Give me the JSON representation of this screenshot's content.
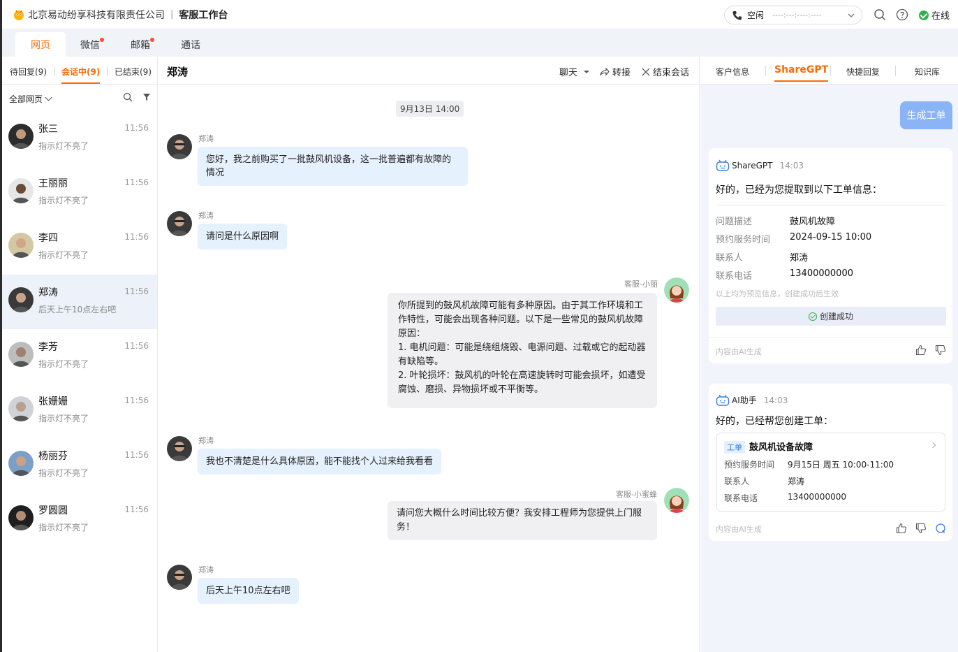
{
  "header": {
    "company": "北京易动纷享科技有限责任公司",
    "separator": "|",
    "app_title": "客服工作台",
    "status_label": "空闲",
    "timer": "----:---:----:----",
    "online_label": "在线"
  },
  "channel_tabs": [
    {
      "label": "网页",
      "active": true,
      "badge": false
    },
    {
      "label": "微信",
      "active": false,
      "badge": true
    },
    {
      "label": "邮箱",
      "active": false,
      "badge": true
    },
    {
      "label": "通话",
      "active": false,
      "badge": false
    }
  ],
  "session_tabs": [
    {
      "label": "待回复(9)"
    },
    {
      "label": "会话中(9)",
      "active": true
    },
    {
      "label": "已结束(9)"
    }
  ],
  "filter_label": "全部网页",
  "contacts": [
    {
      "name": "张三",
      "time": "11:56",
      "preview": "指示灯不亮了"
    },
    {
      "name": "王丽丽",
      "time": "11:56",
      "preview": "指示灯不亮了"
    },
    {
      "name": "李四",
      "time": "11:56",
      "preview": "指示灯不亮了"
    },
    {
      "name": "郑涛",
      "time": "11:56",
      "preview": "后天上午10点左右吧",
      "active": true
    },
    {
      "name": "李芳",
      "time": "11:56",
      "preview": "指示灯不亮了"
    },
    {
      "name": "张姗姗",
      "time": "11:56",
      "preview": "指示灯不亮了"
    },
    {
      "name": "杨丽芬",
      "time": "11:56",
      "preview": "指示灯不亮了"
    },
    {
      "name": "罗圆圆",
      "time": "11:56",
      "preview": "指示灯不亮了"
    }
  ],
  "chat": {
    "title": "郑涛",
    "mode_label": "聊天",
    "transfer_label": "转接",
    "end_label": "结束会话",
    "date_chip": "9月13日  14:00",
    "messages": [
      {
        "sender": "郑涛",
        "text": "您好，我之前购买了一批鼓风机设备，这一批普遍都有故障的情况"
      },
      {
        "sender": "郑涛",
        "text": "请问是什么原因啊"
      },
      {
        "sender": "客服-小丽",
        "text": "你所提到的鼓风机故障可能有多种原因。由于其工作环境和工作特性，可能会出现各种问题。以下是一些常见的鼓风机故障原因：\n1. 电机问题：可能是绕组烧毁、电源问题、过载或它的起动器有缺陷等。\n2. 叶轮损坏：鼓风机的叶轮在高速旋转时可能会损坏，如遭受腐蚀、磨损、异物损坏或不平衡等。"
      },
      {
        "sender": "郑涛",
        "text": "我也不清楚是什么具体原因，能不能找个人过来给我看看"
      },
      {
        "sender": "客服-小蜜蜂",
        "text": "请问您大概什么时间比较方便？我安排工程师为您提供上门服务！"
      },
      {
        "sender": "郑涛",
        "text": "后天上午10点左右吧"
      }
    ]
  },
  "assistant": {
    "tabs": [
      {
        "label": "客户信息"
      },
      {
        "label": "ShareGPT",
        "active": true
      },
      {
        "label": "快捷回复"
      },
      {
        "label": "知识库"
      }
    ],
    "generate_button": "生成工单",
    "card1": {
      "bot_name": "ShareGPT",
      "time": "14:03",
      "lead": "好的，已经为您提取到以下工单信息：",
      "fields": [
        {
          "k": "问题描述",
          "v": "鼓风机故障"
        },
        {
          "k": "预约服务时间",
          "v": "2024-09-15  10:00"
        },
        {
          "k": "联系人",
          "v": "郑涛"
        },
        {
          "k": "联系电话",
          "v": "13400000000"
        }
      ],
      "hint": "以上均为预览信息，创建成功后生效",
      "success": "创建成功",
      "footer_note": "内容由AI生成"
    },
    "card2": {
      "bot_name": "AI助手",
      "time": "14:03",
      "lead": "好的，已经帮您创建工单：",
      "ticket_tag": "工单",
      "ticket_title": "鼓风机设备故障",
      "fields": [
        {
          "k": "预约服务时间",
          "v": "9月15日 周五 10:00-11:00"
        },
        {
          "k": "联系人",
          "v": "郑涛"
        },
        {
          "k": "联系电话",
          "v": "13400000000"
        }
      ],
      "footer_note": "内容由AI生成"
    }
  },
  "colors": {
    "accent": "#ff6a00",
    "incoming_bubble": "#e5f1fc",
    "outgoing_bubble": "#f0f0f2",
    "online": "#2cb44b",
    "primary_button": "#8ab4f5"
  }
}
